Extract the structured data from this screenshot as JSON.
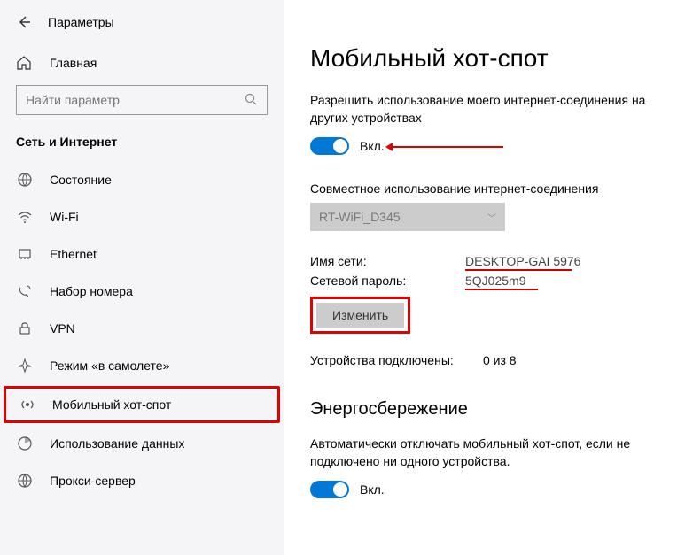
{
  "header": {
    "title": "Параметры"
  },
  "sidebar": {
    "home": "Главная",
    "search_placeholder": "Найти параметр",
    "category": "Сеть и Интернет",
    "items": [
      {
        "label": "Состояние"
      },
      {
        "label": "Wi-Fi"
      },
      {
        "label": "Ethernet"
      },
      {
        "label": "Набор номера"
      },
      {
        "label": "VPN"
      },
      {
        "label": "Режим «в самолете»"
      },
      {
        "label": "Мобильный хот-спот"
      },
      {
        "label": "Использование данных"
      },
      {
        "label": "Прокси-сервер"
      }
    ]
  },
  "main": {
    "title": "Мобильный хот-спот",
    "share_desc": "Разрешить использование моего интернет-соединения на других устройствах",
    "toggle_on": "Вкл.",
    "share_label": "Совместное использование интернет-соединения",
    "share_dropdown": "RT-WiFi_D345",
    "net_name_label": "Имя сети:",
    "net_name_value": "DESKTOP-GAI 5976",
    "net_pass_label": "Сетевой пароль:",
    "net_pass_value": "5QJ025m9",
    "edit_button": "Изменить",
    "devices_label": "Устройства подключены:",
    "devices_value": "0 из 8",
    "power_heading": "Энергосбережение",
    "power_desc": "Автоматически отключать мобильный хот-спот, если не подключено ни одного устройства.",
    "power_toggle": "Вкл."
  }
}
